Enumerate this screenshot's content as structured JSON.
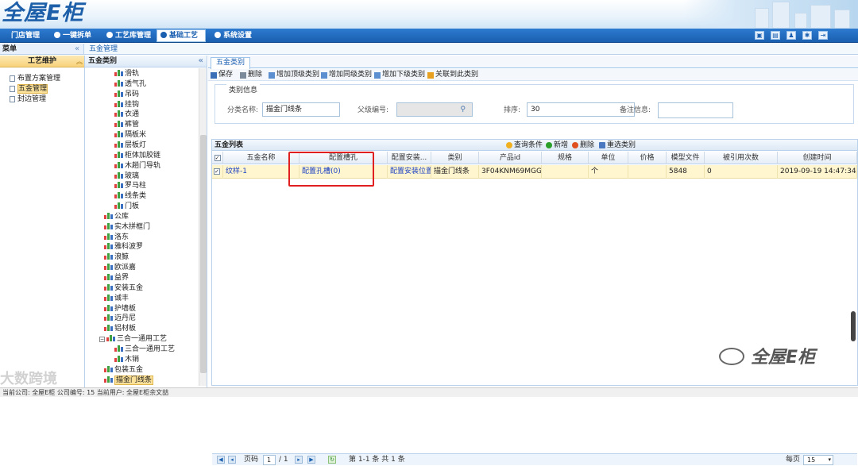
{
  "app": {
    "logo": "全屋E柜"
  },
  "nav": {
    "items": [
      "门店管理",
      "一键拆单",
      "工艺库管理",
      "基础工艺",
      "系统设置"
    ],
    "active": "基础工艺"
  },
  "sidebar": {
    "title": "菜单",
    "section": "工艺维护",
    "items": [
      "布置方案管理",
      "五金管理",
      "封边管理"
    ]
  },
  "breadcrumb": "五金管理",
  "tree": {
    "title": "五金类别",
    "nodes": [
      "滑轨",
      "透气孔",
      "吊码",
      "挂钩",
      "衣通",
      "裤管",
      "隔板米",
      "层板灯",
      "柜体加胶链",
      "木趟门导轨",
      "玻璃",
      "罗马柱",
      "线条类",
      "门板",
      "公库",
      "实木拼框门",
      "洛东",
      "雅科波罗",
      "浪鲸",
      "欧派嘉",
      "益界",
      "安装五金",
      "诚丰",
      "护墙板",
      "迈丹尼",
      "铝材板",
      "三合一通用工艺",
      "三合一通用工艺",
      "木销",
      "包装五金",
      "描金门线条"
    ]
  },
  "tab": "五金类别",
  "toolbar": [
    "保存",
    "删除",
    "增加顶级类别",
    "增加同级类别",
    "增加下级类别",
    "关联到此类别"
  ],
  "form": {
    "legend": "类别信息",
    "name_label": "分类名称:",
    "name_value": "描金门线条",
    "parent_label": "父级编号:",
    "sort_label": "排序:",
    "sort_value": "30",
    "remark_label": "备注信息:"
  },
  "grid": {
    "title": "五金列表",
    "actions": [
      "查询条件",
      "新增",
      "删除",
      "重选类别"
    ],
    "headers": [
      "五金名称",
      "配置槽孔",
      "配置安装...",
      "类别",
      "产品id",
      "规格",
      "单位",
      "价格",
      "模型文件",
      "被引用次数",
      "创建时间"
    ],
    "row": [
      "纹样-1",
      "配置孔槽(0)",
      "配置安装位置",
      "描金门线条",
      "3F04KNM69MGG",
      "",
      "个",
      "",
      "5848",
      "0",
      "2019-09-19 14:47:34"
    ]
  },
  "pager": {
    "page_label": "页码",
    "page": "1",
    "of": "/ 1",
    "summary": "第 1-1 条  共 1 条",
    "per_label": "每页",
    "per": "15"
  },
  "status": "当前公司: 全屋E柜   公司编号: 15   当前用户: 全屋E柜余文喆",
  "watermark": {
    "left": "大数跨境",
    "right": "全屋E柜"
  }
}
